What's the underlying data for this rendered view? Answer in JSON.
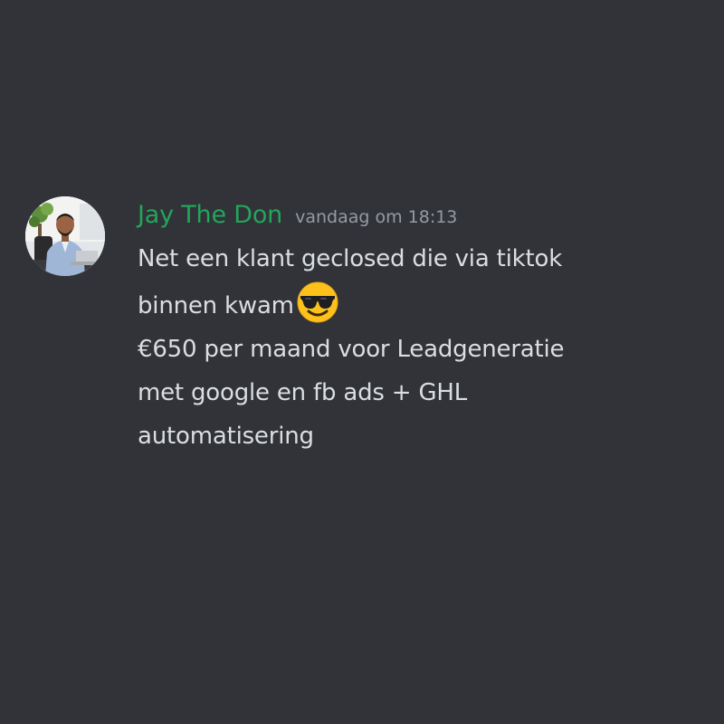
{
  "message": {
    "author": "Jay The Don",
    "timestamp": "vandaag om 18:13",
    "lines": [
      "Net een klant geclosed die via tiktok",
      "binnen kwam",
      "€650 per maand voor Leadgeneratie",
      "met google en fb ads + GHL",
      "automatisering"
    ],
    "emoji": "smiling-face-with-sunglasses-icon"
  },
  "colors": {
    "background": "#313338",
    "username": "#23a55a",
    "timestamp": "#949ba4",
    "text": "#dbdee1"
  }
}
